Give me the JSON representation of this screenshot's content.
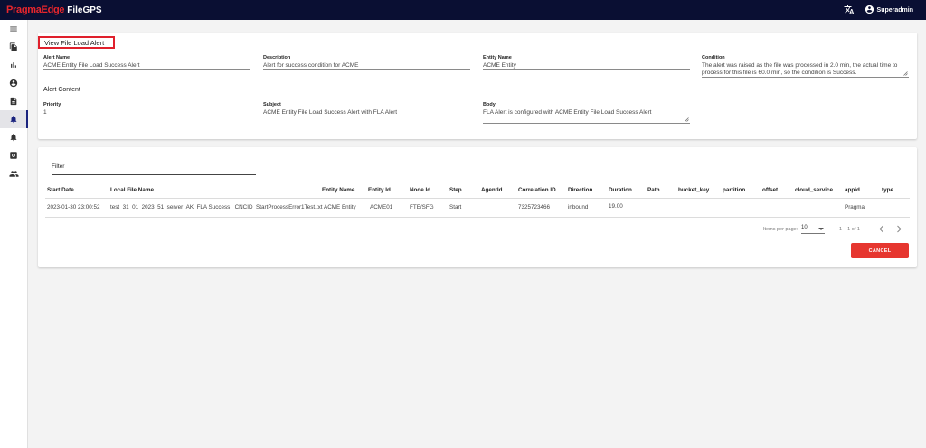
{
  "brand": {
    "company": "PragmaEdge",
    "product": "FileGPS"
  },
  "header": {
    "user_name": "Superadmin",
    "icons": [
      "translate-icon",
      "account-circle-icon"
    ]
  },
  "sidebar": {
    "items": [
      {
        "icon": "menu-icon"
      },
      {
        "icon": "files-icon"
      },
      {
        "icon": "bar-chart-icon"
      },
      {
        "icon": "account-icon"
      },
      {
        "icon": "document-icon"
      },
      {
        "icon": "bell-icon",
        "active": true
      },
      {
        "icon": "bell-settings-icon"
      },
      {
        "icon": "settings-icon"
      },
      {
        "icon": "people-icon"
      }
    ]
  },
  "alert": {
    "title": "View File Load Alert",
    "alert_name_label": "Alert Name",
    "alert_name": "ACME Entity File Load Success Alert",
    "description_label": "Description",
    "description": "Alert for success condition for ACME",
    "entity_name_label": "Entity Name",
    "entity_name": "ACME Entity",
    "condition_label": "Condition",
    "condition": "The alert was raised as the file was processed in 2.0 min, the actual time to process for this file is 60.0 min, so the condition is Success.",
    "content_title": "Alert Content",
    "priority_label": "Priority",
    "priority": "1",
    "subject_label": "Subject",
    "subject": "ACME Entity File Load Success Alert with FLA Alert",
    "body_label": "Body",
    "body": "FLA Alert is configured with ACME Entity File Load Success Alert"
  },
  "table": {
    "filter_label": "Filter",
    "columns": [
      "Start Date",
      "Local File Name",
      "Entity Name",
      "Entity Id",
      "Node Id",
      "Step",
      "AgentId",
      "Correlation ID",
      "Direction",
      "Duration",
      "Path",
      "bucket_key",
      "partition",
      "offset",
      "cloud_service",
      "appid",
      "type"
    ],
    "rows": [
      [
        "2023-01-30 23:00:52",
        "test_31_01_2023_51_server_AK_FLA Success _CNCID_StartProcessError1Test.txt",
        "ACME Entity",
        "ACME01",
        "FTE/SFG",
        "Start",
        "",
        "7325723466",
        "inbound",
        "19.00",
        "",
        "",
        "",
        "",
        "",
        "Pragma",
        ""
      ]
    ]
  },
  "pagination": {
    "items_per_page_label": "Items per page:",
    "page_size": "10",
    "range": "1 – 1 of 1"
  },
  "actions": {
    "cancel": "CANCEL"
  },
  "colors": {
    "topbar": "#0a0f33",
    "brand_red": "#e8262c",
    "cancel": "#e6362f",
    "highlight": "#e0202c"
  }
}
